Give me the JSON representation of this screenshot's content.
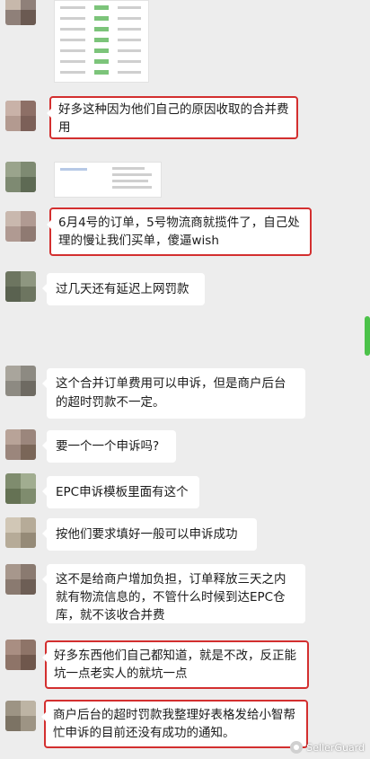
{
  "messages": [
    {
      "text": "好多这种因为他们自己的原因收取的合并费用"
    },
    {
      "text": "6月4号的订单，5号物流商就揽件了，自己处理的慢让我们买单，傻逼wish"
    },
    {
      "text": "过几天还有延迟上网罚款"
    },
    {
      "text": "这个合并订单费用可以申诉，但是商户后台的超时罚款不一定。"
    },
    {
      "text": "要一个一个申诉吗?"
    },
    {
      "text": "EPC申诉模板里面有这个"
    },
    {
      "text": "按他们要求填好一般可以申诉成功"
    },
    {
      "text": "这不是给商户增加负担，订单释放三天之内就有物流信息的，不管什么时候到达EPC仓库，就不该收合并费"
    },
    {
      "text": "好多东西他们自己都知道，就是不改，反正能坑一点老实人的就坑一点"
    },
    {
      "text": "商户后台的超时罚款我整理好表格发给小智帮忙申诉的目前还没有成功的通知。"
    }
  ],
  "watermark": {
    "text": "SellerGuard"
  },
  "colors": {
    "highlight": "#d32f2f",
    "bubble": "#ffffff",
    "background": "#ededed"
  }
}
